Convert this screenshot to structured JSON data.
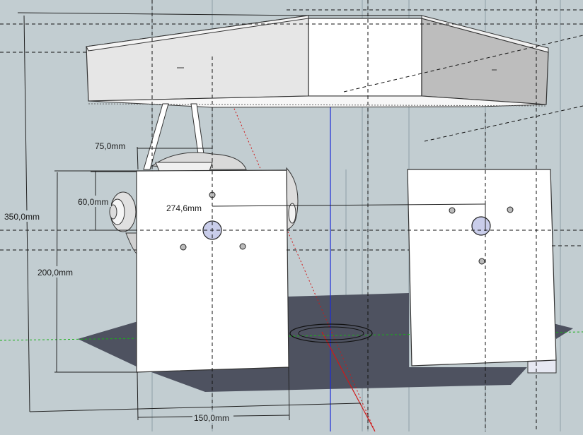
{
  "dimensions": {
    "overall_height": "350,0mm",
    "plate_height": "200,0mm",
    "hole_offset_vertical": "60,0mm",
    "mount_width": "75,0mm",
    "plate_width": "150,0mm",
    "hole_spacing": "274,6mm"
  },
  "colors": {
    "background": "#c2cdd1",
    "shadow": "#4e5260",
    "plate": "#ffffff",
    "top_light": "#e8e8e8",
    "top_dark": "#bdbdbd",
    "axis_blue": "#1b2bd8",
    "axis_red": "#d01818",
    "axis_green": "#18b018"
  }
}
